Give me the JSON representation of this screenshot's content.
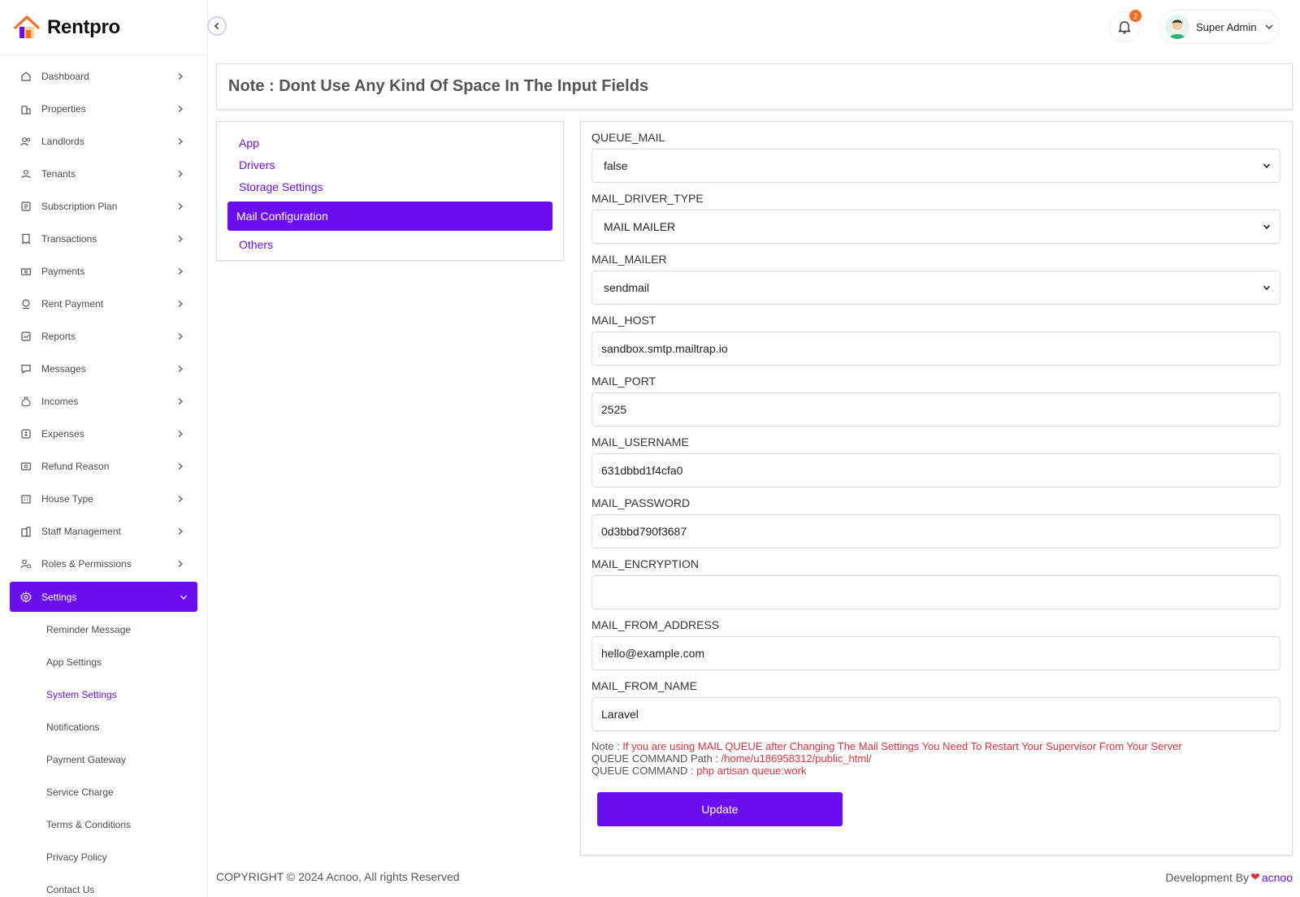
{
  "brand": {
    "name": "Rentpro"
  },
  "header": {
    "notification_count": "2",
    "user_name": "Super Admin"
  },
  "sidebar": {
    "items": [
      {
        "label": "Dashboard",
        "icon": "home-icon"
      },
      {
        "label": "Properties",
        "icon": "building-icon"
      },
      {
        "label": "Landlords",
        "icon": "users-icon"
      },
      {
        "label": "Tenants",
        "icon": "user-group-icon"
      },
      {
        "label": "Subscription Plan",
        "icon": "subscription-icon"
      },
      {
        "label": "Transactions",
        "icon": "receipt-icon"
      },
      {
        "label": "Payments",
        "icon": "payment-icon"
      },
      {
        "label": "Rent Payment",
        "icon": "rent-icon"
      },
      {
        "label": "Reports",
        "icon": "report-icon"
      },
      {
        "label": "Messages",
        "icon": "message-icon"
      },
      {
        "label": "Incomes",
        "icon": "money-bag-icon"
      },
      {
        "label": "Expenses",
        "icon": "expense-icon"
      },
      {
        "label": "Refund Reason",
        "icon": "refund-icon"
      },
      {
        "label": "House Type",
        "icon": "house-icon"
      },
      {
        "label": "Staff Management",
        "icon": "staff-icon"
      },
      {
        "label": "Roles & Permissions",
        "icon": "roles-icon"
      },
      {
        "label": "Settings",
        "icon": "gear-icon"
      }
    ],
    "settings_sub": [
      "Reminder Message",
      "App Settings",
      "System Settings",
      "Notifications",
      "Payment Gateway",
      "Service Charge",
      "Terms & Conditions",
      "Privacy Policy",
      "Contact Us"
    ]
  },
  "note": "Note : Dont Use Any Kind Of Space In The Input Fields",
  "settings_menu": [
    "App",
    "Drivers",
    "Storage Settings",
    "Mail Configuration",
    "Others"
  ],
  "form": {
    "queue_mail": {
      "label": "QUEUE_MAIL",
      "value": "false"
    },
    "mail_driver_type": {
      "label": "MAIL_DRIVER_TYPE",
      "value": "MAIL MAILER"
    },
    "mail_mailer": {
      "label": "MAIL_MAILER",
      "value": "sendmail"
    },
    "mail_host": {
      "label": "MAIL_HOST",
      "value": "sandbox.smtp.mailtrap.io"
    },
    "mail_port": {
      "label": "MAIL_PORT",
      "value": "2525"
    },
    "mail_username": {
      "label": "MAIL_USERNAME",
      "value": "631dbbd1f4cfa0"
    },
    "mail_password": {
      "label": "MAIL_PASSWORD",
      "value": "0d3bbd790f3687"
    },
    "mail_encryption": {
      "label": "MAIL_ENCRYPTION",
      "value": ""
    },
    "mail_from_address": {
      "label": "MAIL_FROM_ADDRESS",
      "value": "hello@example.com"
    },
    "mail_from_name": {
      "label": "MAIL_FROM_NAME",
      "value": "Laravel"
    },
    "help": {
      "note_prefix": "Note : ",
      "note_text": "If you are using MAIL QUEUE after Changing The Mail Settings You Need To Restart Your Supervisor From Your Server",
      "path_prefix": "QUEUE COMMAND Path : ",
      "path_value": "/home/u186958312/public_html/",
      "cmd_prefix": "QUEUE COMMAND : ",
      "cmd_value": "php artisan queue:work"
    },
    "update_label": "Update"
  },
  "footer": {
    "copyright": "COPYRIGHT © 2024 Acnoo, All rights Reserved",
    "dev_prefix": "Development By",
    "dev_brand": "acnoo"
  },
  "colors": {
    "accent": "#6a0ef0",
    "danger": "#e0303e",
    "badge": "#f36c21"
  }
}
